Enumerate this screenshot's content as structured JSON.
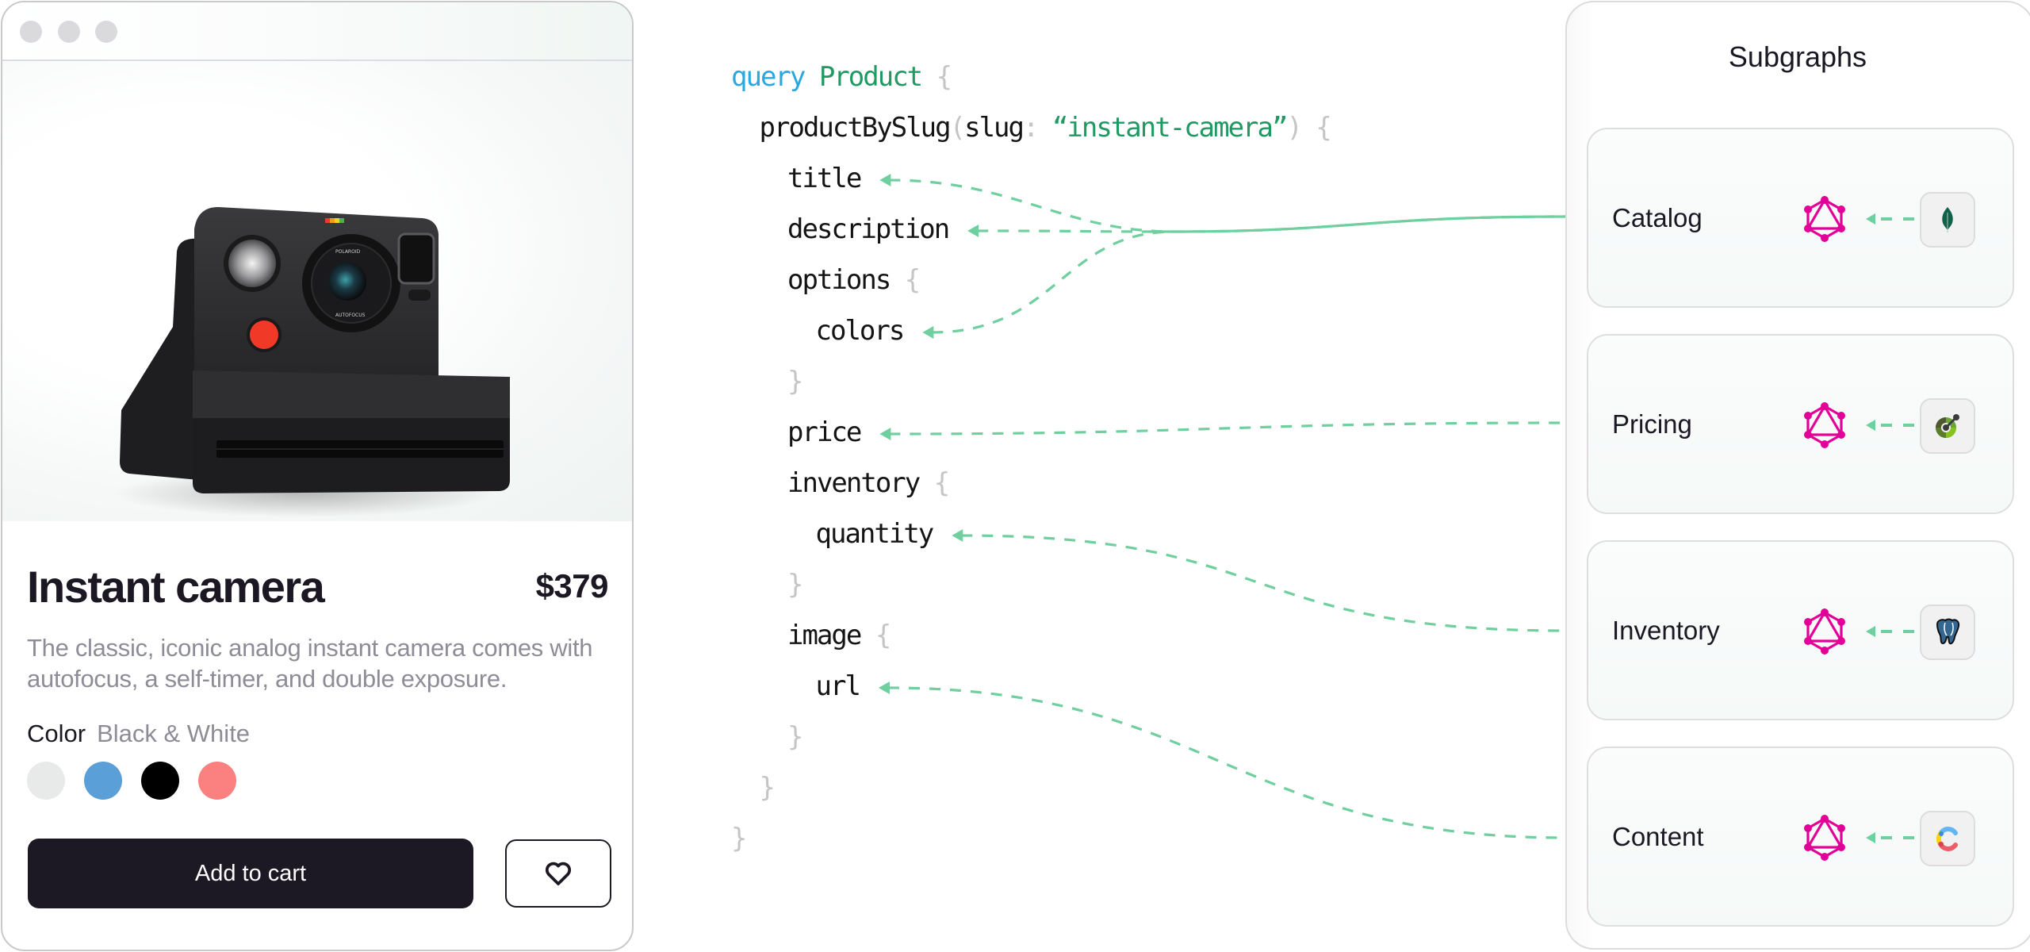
{
  "product_window": {
    "traffic_lights": [
      "close",
      "minimize",
      "maximize"
    ],
    "product": {
      "title": "Instant camera",
      "price": "$379",
      "description": "The classic, iconic analog instant camera comes with autofocus, a self-timer, and double exposure.",
      "color_label": "Color",
      "selected_color": "Black & White",
      "swatches": [
        {
          "name": "Black & White",
          "hex": "#e8e9e9"
        },
        {
          "name": "Blue",
          "hex": "#5a9fd8"
        },
        {
          "name": "Black",
          "hex": "#000000"
        },
        {
          "name": "Coral",
          "hex": "#fb8181"
        }
      ],
      "add_to_cart_label": "Add to cart",
      "favorite_icon": "heart-icon"
    }
  },
  "query": {
    "lines": [
      {
        "indent": 0,
        "tokens": [
          {
            "t": "query",
            "c": "kw"
          },
          {
            "t": " ",
            "c": "field"
          },
          {
            "t": "Product",
            "c": "type"
          },
          {
            "t": " {",
            "c": "punc"
          }
        ]
      },
      {
        "indent": 1,
        "tokens": [
          {
            "t": "productBySlug",
            "c": "field"
          },
          {
            "t": "(",
            "c": "punc"
          },
          {
            "t": "slug",
            "c": "field"
          },
          {
            "t": ": ",
            "c": "punc"
          },
          {
            "t": "“instant-camera”",
            "c": "str"
          },
          {
            "t": ") {",
            "c": "punc"
          }
        ]
      },
      {
        "indent": 2,
        "tokens": [
          {
            "t": "title",
            "c": "field"
          }
        ]
      },
      {
        "indent": 2,
        "tokens": [
          {
            "t": "description",
            "c": "field"
          }
        ]
      },
      {
        "indent": 2,
        "tokens": [
          {
            "t": "options",
            "c": "field"
          },
          {
            "t": " {",
            "c": "punc"
          }
        ]
      },
      {
        "indent": 3,
        "tokens": [
          {
            "t": "colors",
            "c": "field"
          }
        ]
      },
      {
        "indent": 2,
        "tokens": [
          {
            "t": "}",
            "c": "punc"
          }
        ]
      },
      {
        "indent": 2,
        "tokens": [
          {
            "t": "price",
            "c": "field"
          }
        ]
      },
      {
        "indent": 2,
        "tokens": [
          {
            "t": "inventory",
            "c": "field"
          },
          {
            "t": " {",
            "c": "punc"
          }
        ]
      },
      {
        "indent": 3,
        "tokens": [
          {
            "t": "quantity",
            "c": "field"
          }
        ]
      },
      {
        "indent": 2,
        "tokens": [
          {
            "t": "}",
            "c": "punc"
          }
        ]
      },
      {
        "indent": 2,
        "tokens": [
          {
            "t": "image",
            "c": "field"
          },
          {
            "t": " {",
            "c": "punc"
          }
        ]
      },
      {
        "indent": 3,
        "tokens": [
          {
            "t": "url",
            "c": "field"
          }
        ]
      },
      {
        "indent": 2,
        "tokens": [
          {
            "t": "}",
            "c": "punc"
          }
        ]
      },
      {
        "indent": 1,
        "tokens": [
          {
            "t": "}",
            "c": "punc"
          }
        ]
      },
      {
        "indent": 0,
        "tokens": [
          {
            "t": "}",
            "c": "punc"
          }
        ]
      }
    ]
  },
  "connections": [
    {
      "field": "title",
      "subgraph": "Catalog"
    },
    {
      "field": "description",
      "subgraph": "Catalog"
    },
    {
      "field": "colors",
      "subgraph": "Catalog"
    },
    {
      "field": "price",
      "subgraph": "Pricing"
    },
    {
      "field": "quantity",
      "subgraph": "Inventory"
    },
    {
      "field": "url",
      "subgraph": "Content"
    }
  ],
  "connector_color": "#6fcf9e",
  "graphql_color": "#e10098",
  "subgraphs": {
    "title": "Subgraphs",
    "items": [
      {
        "name": "Catalog",
        "source_icon": "mongodb-leaf-icon"
      },
      {
        "name": "Pricing",
        "source_icon": "openapi-icon"
      },
      {
        "name": "Inventory",
        "source_icon": "postgresql-elephant-icon"
      },
      {
        "name": "Content",
        "source_icon": "contentful-icon"
      }
    ]
  }
}
